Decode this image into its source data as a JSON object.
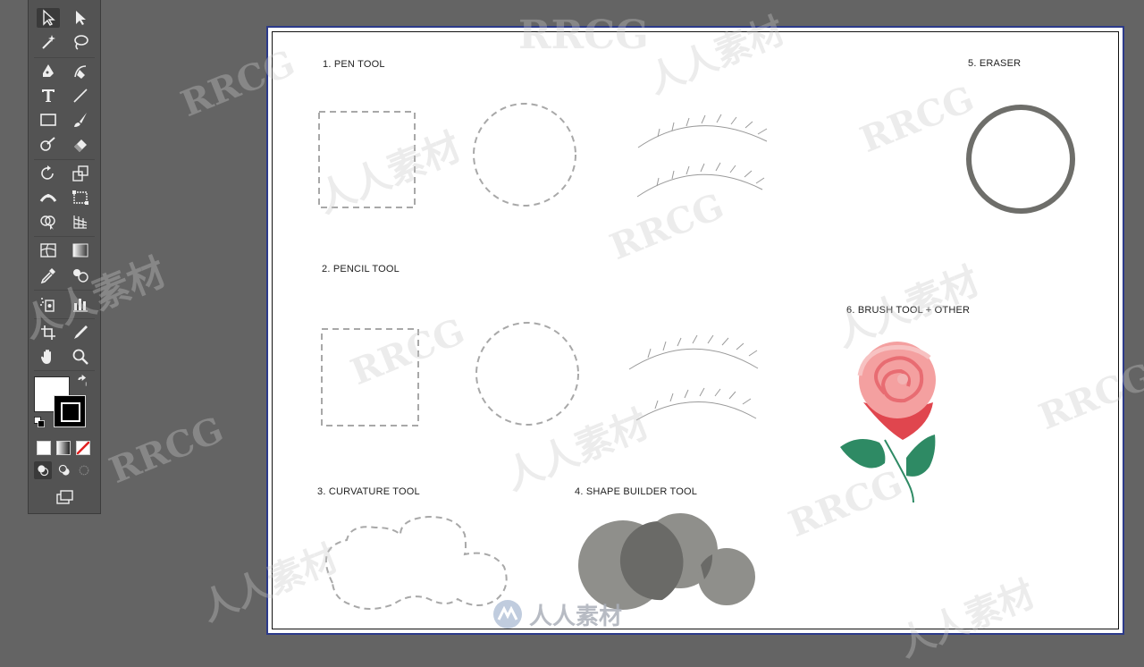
{
  "toolbar": {
    "tools": [
      {
        "name": "selection-tool",
        "icon": "arrow-icon"
      },
      {
        "name": "direct-selection-tool",
        "icon": "white-arrow-icon"
      },
      {
        "name": "magic-wand-tool",
        "icon": "wand-icon"
      },
      {
        "name": "lasso-tool",
        "icon": "lasso-icon"
      },
      {
        "name": "pen-tool",
        "icon": "pen-icon"
      },
      {
        "name": "curvature-tool",
        "icon": "curvature-icon"
      },
      {
        "name": "type-tool",
        "icon": "type-icon"
      },
      {
        "name": "line-tool",
        "icon": "line-icon"
      },
      {
        "name": "rectangle-tool",
        "icon": "rectangle-icon"
      },
      {
        "name": "paintbrush-tool",
        "icon": "brush-icon"
      },
      {
        "name": "shaper-tool",
        "icon": "shaper-icon"
      },
      {
        "name": "eraser-tool",
        "icon": "eraser-icon"
      },
      {
        "name": "rotate-tool",
        "icon": "rotate-icon"
      },
      {
        "name": "scale-tool",
        "icon": "scale-icon"
      },
      {
        "name": "width-tool",
        "icon": "width-icon"
      },
      {
        "name": "free-transform-tool",
        "icon": "free-transform-icon"
      },
      {
        "name": "shape-builder-tool",
        "icon": "shape-builder-icon"
      },
      {
        "name": "perspective-grid-tool",
        "icon": "perspective-icon"
      },
      {
        "name": "mesh-tool",
        "icon": "mesh-icon"
      },
      {
        "name": "gradient-tool",
        "icon": "gradient-icon"
      },
      {
        "name": "eyedropper-tool",
        "icon": "eyedropper-icon"
      },
      {
        "name": "blend-tool",
        "icon": "blend-icon"
      },
      {
        "name": "symbol-sprayer-tool",
        "icon": "symbol-sprayer-icon"
      },
      {
        "name": "graph-tool",
        "icon": "graph-icon"
      },
      {
        "name": "artboard-tool",
        "icon": "artboard-icon"
      },
      {
        "name": "slice-tool",
        "icon": "slice-icon"
      },
      {
        "name": "hand-tool",
        "icon": "hand-icon"
      },
      {
        "name": "zoom-tool",
        "icon": "zoom-icon"
      }
    ],
    "fill_color": "#ffffff",
    "stroke_color": "#000000"
  },
  "artboard": {
    "labels": {
      "pen": "1. PEN TOOL",
      "pencil": "2. PENCIL TOOL",
      "curvature": "3. CURVATURE TOOL",
      "shape_builder": "4. SHAPE BUILDER TOOL",
      "eraser": "5. ERASER",
      "brush": "6. BRUSH TOOL + OTHER"
    }
  },
  "watermarks": {
    "rrcg": "RRCG",
    "cn": "人人素材"
  },
  "colors": {
    "canvas_bg": "#646464",
    "artboard_border": "#2c3a8a",
    "circle_gray": "#6e6e6a",
    "shape_gray": "#8c8c88",
    "rose_pink": "#f08a8a",
    "leaf_green": "#2e8a64"
  }
}
